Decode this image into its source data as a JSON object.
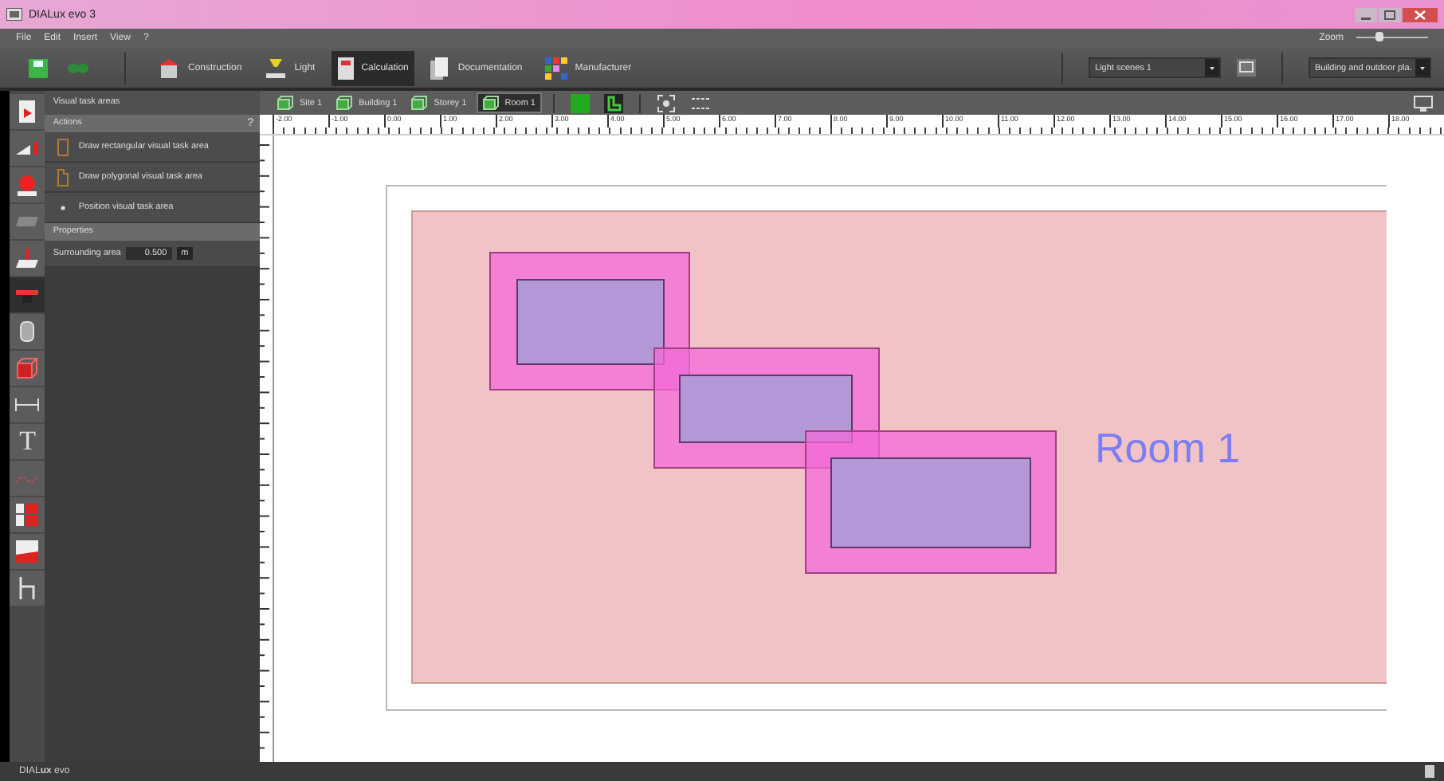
{
  "window": {
    "title": "DIALux evo 3"
  },
  "menu": [
    "File",
    "Edit",
    "Insert",
    "View",
    "?"
  ],
  "zoom": {
    "label": "Zoom",
    "level": 0.3
  },
  "mode_tabs": [
    {
      "label": "Construction",
      "kind": "construction",
      "selected": false
    },
    {
      "label": "Light",
      "kind": "light",
      "selected": false
    },
    {
      "label": "Calculation",
      "kind": "calculation",
      "selected": true
    },
    {
      "label": "Documentation",
      "kind": "documentation",
      "selected": false
    },
    {
      "label": "Manufacturer",
      "kind": "manufacturer",
      "selected": false
    }
  ],
  "light_scene": {
    "value": "Light scenes 1"
  },
  "view_select": {
    "value": "Building and outdoor pla."
  },
  "tools": [
    {
      "kind": "luminaire",
      "selected": false
    },
    {
      "kind": "sensor",
      "selected": false
    },
    {
      "kind": "lamp",
      "selected": false
    },
    {
      "kind": "surface",
      "selected": false
    },
    {
      "kind": "calc-surface",
      "selected": false
    },
    {
      "kind": "desk",
      "selected": true
    },
    {
      "kind": "cylinder",
      "selected": false
    },
    {
      "kind": "cube",
      "selected": false
    },
    {
      "kind": "dimension",
      "selected": false
    },
    {
      "kind": "text",
      "glyph": "T",
      "selected": false
    },
    {
      "kind": "curve",
      "selected": false
    },
    {
      "kind": "grid",
      "selected": false
    },
    {
      "kind": "chart",
      "selected": false
    },
    {
      "kind": "path",
      "selected": false
    }
  ],
  "panel": {
    "title": "Visual task areas",
    "actions_heading": "Actions",
    "help": "?",
    "actions": [
      {
        "label": "Draw rectangular visual task area",
        "kind": "rect"
      },
      {
        "label": "Draw polygonal visual task area",
        "kind": "poly"
      },
      {
        "label": "Position visual task area",
        "kind": "dot"
      }
    ],
    "properties_heading": "Properties",
    "surrounding_label": "Surrounding area",
    "surrounding_value": "0.500",
    "surrounding_unit": "m"
  },
  "breadcrumb": [
    {
      "label": "Site 1",
      "selected": false
    },
    {
      "label": "Building 1",
      "selected": false
    },
    {
      "label": "Storey 1",
      "selected": false
    },
    {
      "label": "Room 1",
      "selected": true
    }
  ],
  "ruler": [
    "-2.00",
    "-1.00",
    "0.00",
    "1.00",
    "2.00",
    "3.00",
    "4.00",
    "5.00",
    "6.00",
    "7.00",
    "8.00",
    "9.00",
    "10.00",
    "11.00",
    "12.00",
    "13.00",
    "14.00",
    "15.00",
    "16.00",
    "17.00",
    "18.00"
  ],
  "canvas": {
    "room_label": "Room 1"
  },
  "status_bar": {
    "brand": "DIAL**ux** evo"
  }
}
